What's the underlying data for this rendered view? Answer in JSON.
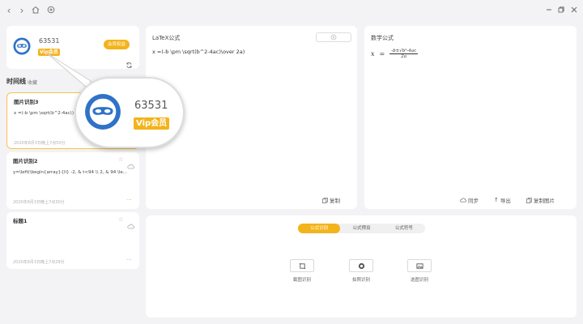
{
  "titlebar": {
    "back_icon": "chevron-left-icon",
    "forward_icon": "chevron-right-icon",
    "home_icon": "home-icon",
    "add_icon": "plus-circle-icon",
    "window_controls": [
      "minimize-icon",
      "restore-icon",
      "close-icon"
    ]
  },
  "user": {
    "name": "63531",
    "vip_badge": "Vip会员",
    "member_button": "会员权益",
    "refresh_icon": "refresh-icon"
  },
  "history": {
    "tab_active": "时间线",
    "tab_other": "收藏",
    "items": [
      {
        "title": "图片识别3",
        "content": "x =(-b \\pm \\sqrt(b^2-4ac))",
        "date": "2020年8月3日晚上7点50分"
      },
      {
        "title": "图片识别2",
        "content": "y=\\left(\\begin{array}{ll} -2, & t<94 \\\\ 2, & 94 \\le...",
        "date": "2020年8月3日晚上7点30分"
      },
      {
        "title": "标题1",
        "content": "",
        "date": "2020年8月3日晚上7点29分"
      }
    ]
  },
  "latex": {
    "title": "LaTeX公式",
    "code": "x =(-b \\pm \\sqrt(b^2-4ac)\\over 2a)",
    "copy": "复制"
  },
  "math": {
    "title": "数学公式",
    "lhs": "x",
    "numerator": "-b±√b²-4ac",
    "denominator": "2a",
    "sync": "同步",
    "export": "导出",
    "copy_image": "复制图片"
  },
  "tools": {
    "tabs": [
      "公式识别",
      "公式预设",
      "公式符号"
    ],
    "active_tab": 0,
    "buttons": [
      {
        "label": "截图识别",
        "icon": "screenshot-icon"
      },
      {
        "label": "拍照识别",
        "icon": "camera-icon"
      },
      {
        "label": "选图识别",
        "icon": "image-icon"
      }
    ]
  },
  "colors": {
    "accent": "#f3b31b",
    "avatar_blue": "#2f72c8"
  }
}
